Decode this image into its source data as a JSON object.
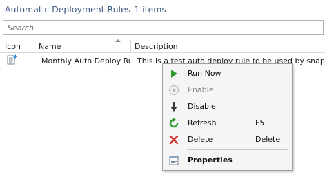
{
  "header": {
    "title": "Automatic Deployment Rules",
    "count": "1 items"
  },
  "search": {
    "placeholder": "Search"
  },
  "columns": {
    "icon": "Icon",
    "name": "Name",
    "description": "Description"
  },
  "rows": [
    {
      "icon": "deployment-rule-icon",
      "name": "Monthly Auto Deploy Rule",
      "description": "This is a test auto deploy rule to be used by snapatch"
    }
  ],
  "context_menu": {
    "items": [
      {
        "label": "Run Now",
        "shortcut": "",
        "icon": "play-icon",
        "enabled": true
      },
      {
        "label": "Enable",
        "shortcut": "",
        "icon": "enable-icon",
        "enabled": false
      },
      {
        "label": "Disable",
        "shortcut": "",
        "icon": "down-arrow-icon",
        "enabled": true
      },
      {
        "label": "Refresh",
        "shortcut": "F5",
        "icon": "refresh-icon",
        "enabled": true
      },
      {
        "label": "Delete",
        "shortcut": "Delete",
        "icon": "delete-x-icon",
        "enabled": true
      },
      {
        "label": "Properties",
        "shortcut": "",
        "icon": "properties-icon",
        "enabled": true,
        "bold": true
      }
    ]
  },
  "colors": {
    "title": "#3c5a82",
    "run_now_green": "#2e9b2e",
    "delete_red": "#d0342c",
    "menu_background": "#f5f5f5"
  }
}
